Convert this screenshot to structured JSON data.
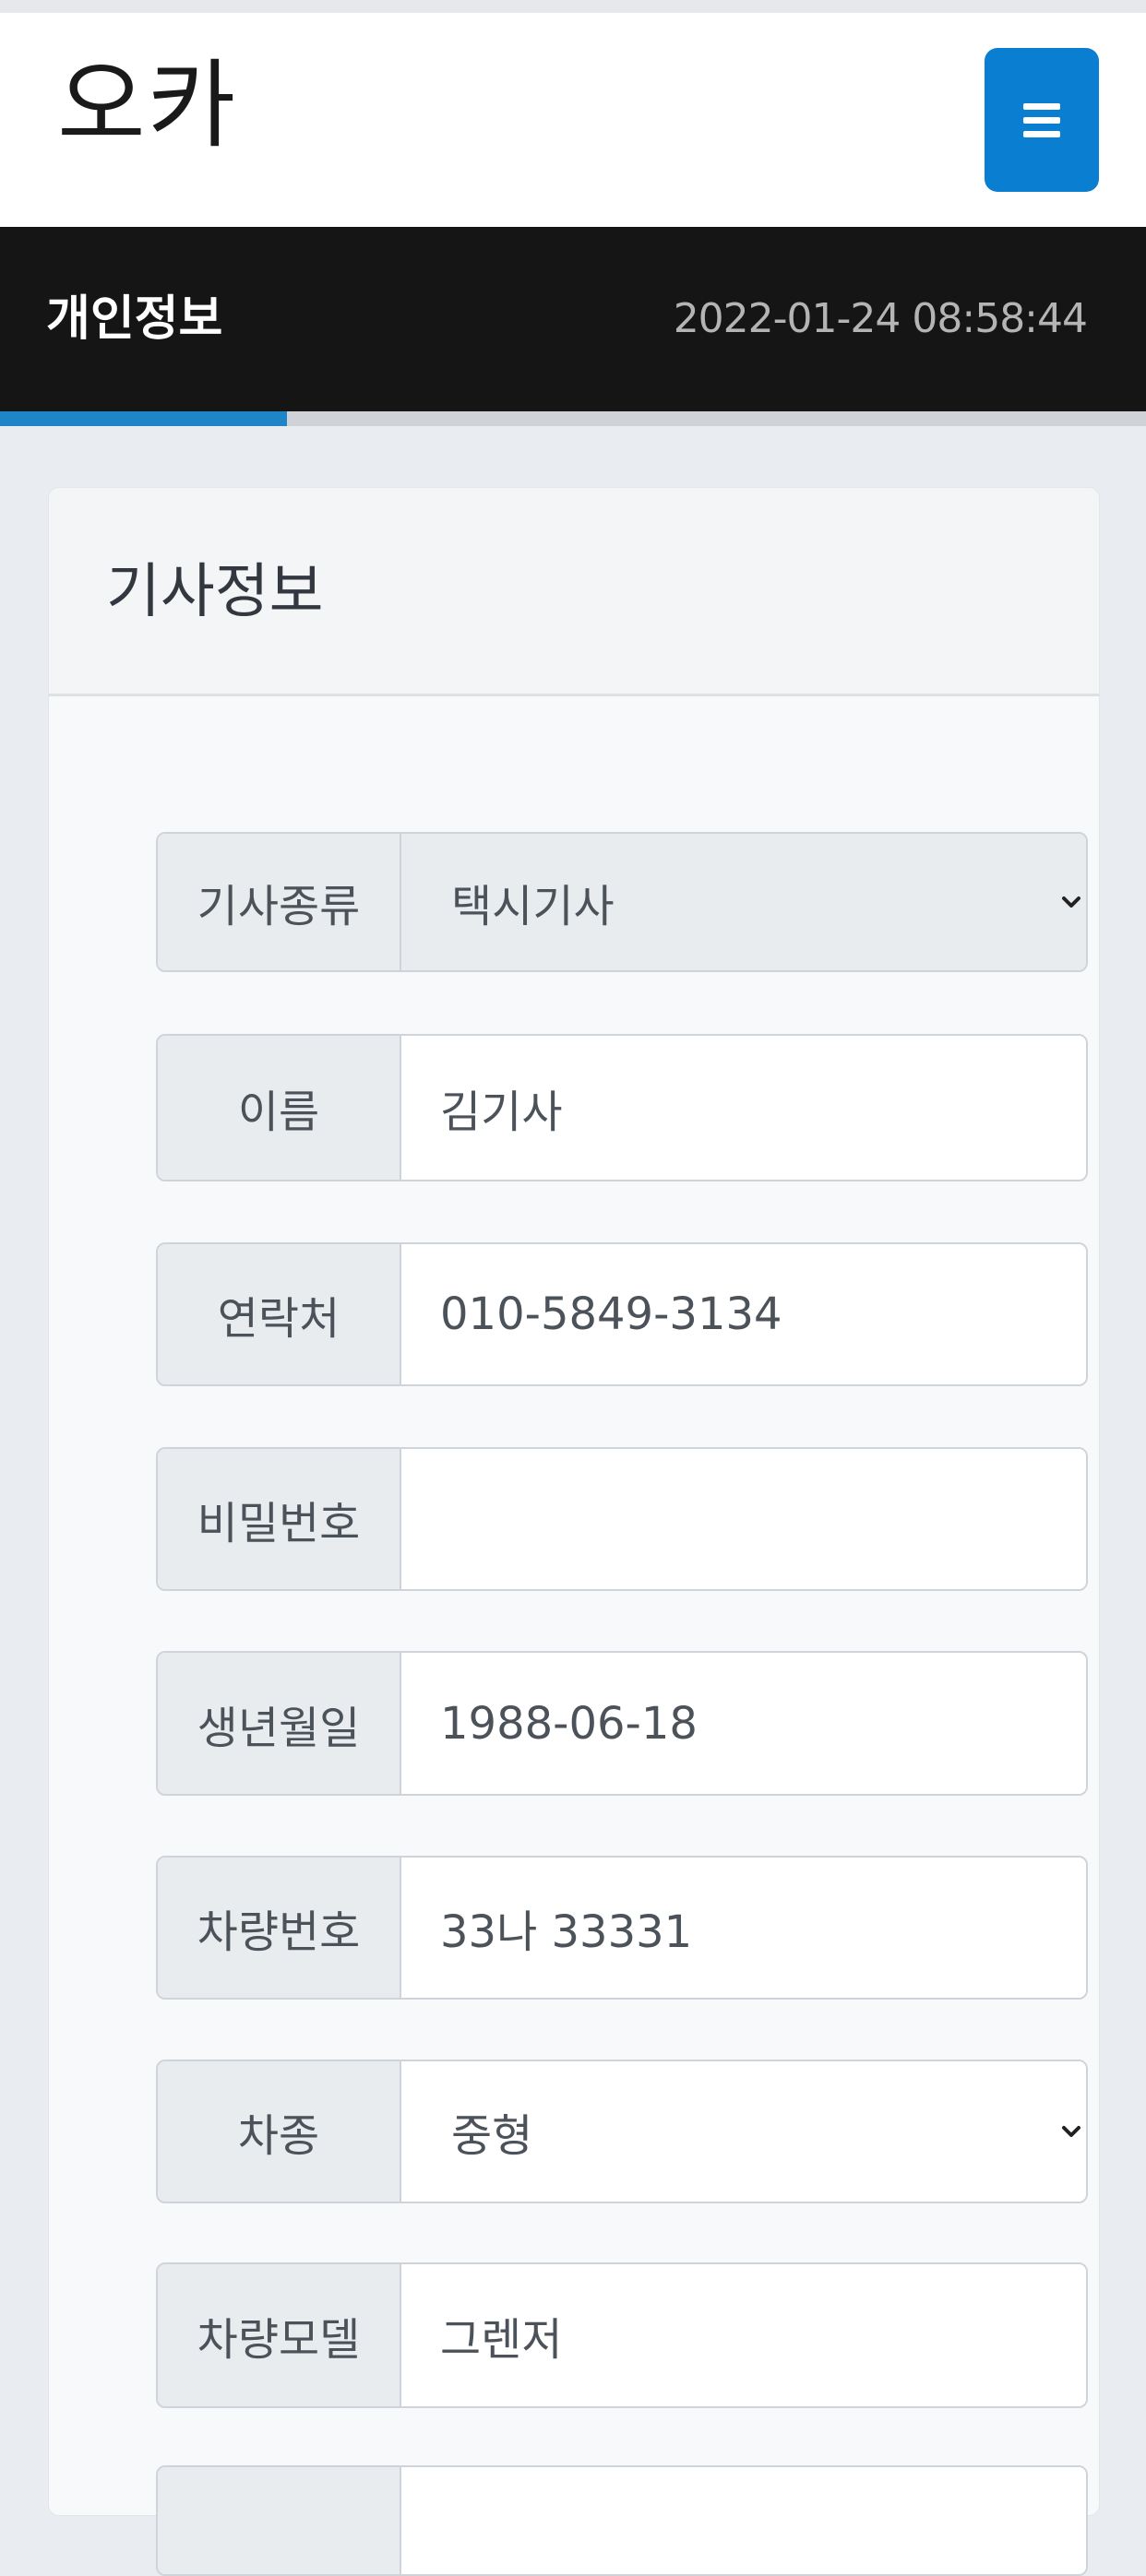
{
  "app": {
    "logo": "오카",
    "menu_icon": "hamburger-icon"
  },
  "titlebar": {
    "title": "개인정보",
    "datetime": "2022-01-24 08:58:44",
    "progress": 0.25
  },
  "card": {
    "title": "기사정보"
  },
  "fields": [
    {
      "label": "기사종류",
      "value": "택시기사",
      "type": "select"
    },
    {
      "label": "이름",
      "value": "김기사",
      "type": "text"
    },
    {
      "label": "연락처",
      "value": "010-5849-3134",
      "type": "text"
    },
    {
      "label": "비밀번호",
      "value": "",
      "type": "password"
    },
    {
      "label": "생년월일",
      "value": "1988-06-18",
      "type": "text"
    },
    {
      "label": "차량번호",
      "value": "33나 33331",
      "type": "text"
    },
    {
      "label": "차종",
      "value": "중형",
      "type": "select"
    },
    {
      "label": "차량모델",
      "value": "그렌저",
      "type": "text"
    }
  ],
  "colors": {
    "accent": "#0a7fd1",
    "titlebar_bg": "#151515",
    "progress": "#1d85c8",
    "page_bg": "#e9ecf0"
  }
}
